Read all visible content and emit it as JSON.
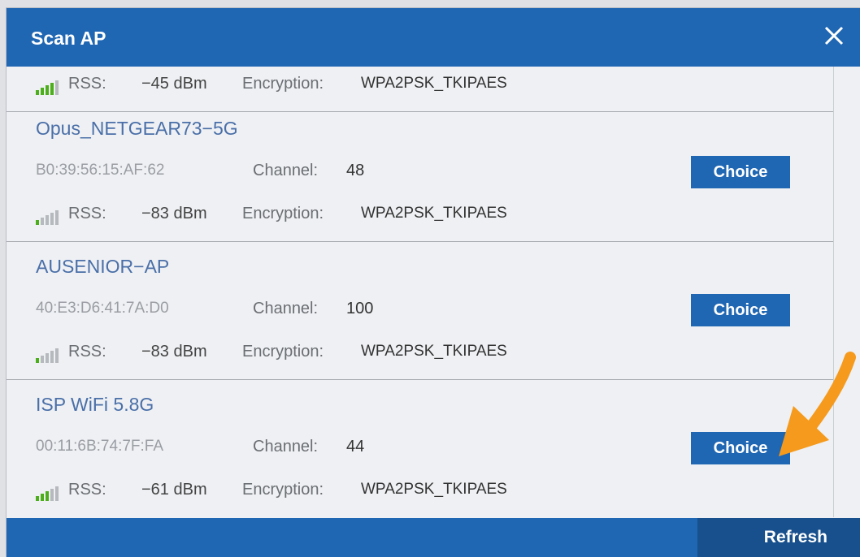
{
  "dialog": {
    "title": "Scan AP"
  },
  "labels": {
    "rss": "RSS:",
    "encryption": "Encryption:",
    "channel": "Channel:"
  },
  "networks": [
    {
      "rss": "−45 dBm",
      "encryption": "WPA2PSK_TKIPAES",
      "signal_level": 4
    },
    {
      "ssid": "Opus_NETGEAR73−5G",
      "mac": "B0:39:56:15:AF:62",
      "channel": "48",
      "rss": "−83 dBm",
      "encryption": "WPA2PSK_TKIPAES",
      "signal_level": 1,
      "action": "Choice"
    },
    {
      "ssid": "AUSENIOR−AP",
      "mac": "40:E3:D6:41:7A:D0",
      "channel": "100",
      "rss": "−83 dBm",
      "encryption": "WPA2PSK_TKIPAES",
      "signal_level": 1,
      "action": "Choice"
    },
    {
      "ssid": "ISP WiFi 5.8G",
      "mac": "00:11:6B:74:7F:FA",
      "channel": "44",
      "rss": "−61 dBm",
      "encryption": "WPA2PSK_TKIPAES",
      "signal_level": 3,
      "action": "Choice"
    }
  ],
  "footer": {
    "refresh_label": "Refresh"
  },
  "icons": {
    "close": "close-icon",
    "signal": "signal-strength-icon",
    "annotation": "arrow-annotation"
  },
  "colors": {
    "primary": "#1f66b3",
    "signal_on": "#4cae1a",
    "signal_off": "#b6b9bd",
    "annotation": "#f59a1c"
  }
}
